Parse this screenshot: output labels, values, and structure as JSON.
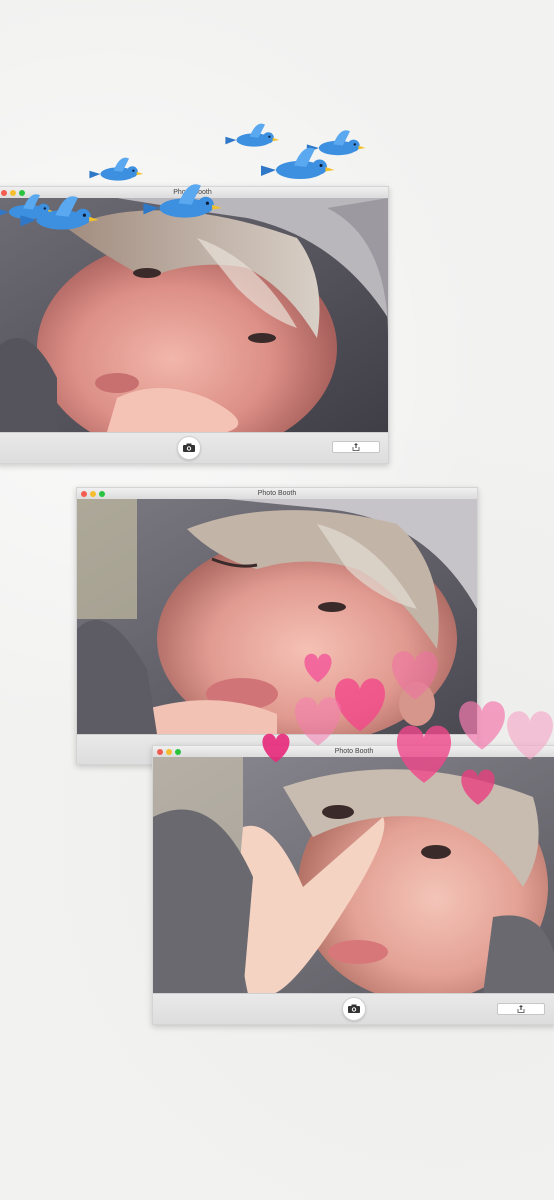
{
  "windows": [
    {
      "id": "top",
      "title": "Photo Booth"
    },
    {
      "id": "middle",
      "title": "Photo Booth"
    },
    {
      "id": "bottom",
      "title": "Photo Booth"
    }
  ],
  "icons": {
    "shutter": "camera-icon",
    "share": "share-icon",
    "close": "close-light",
    "minimize": "minimize-light",
    "zoom": "zoom-light"
  },
  "stickers": {
    "birds": "bluebird-sticker",
    "hearts": "heart-sticker"
  },
  "colors": {
    "background": "#f2f2f1",
    "window_chrome": "#ececec",
    "close": "#f45c50",
    "minimize": "#f6bd2f",
    "zoom": "#2ac33f",
    "bird_blue": "#3d8fe0",
    "heart_pink": "#f0478a"
  }
}
